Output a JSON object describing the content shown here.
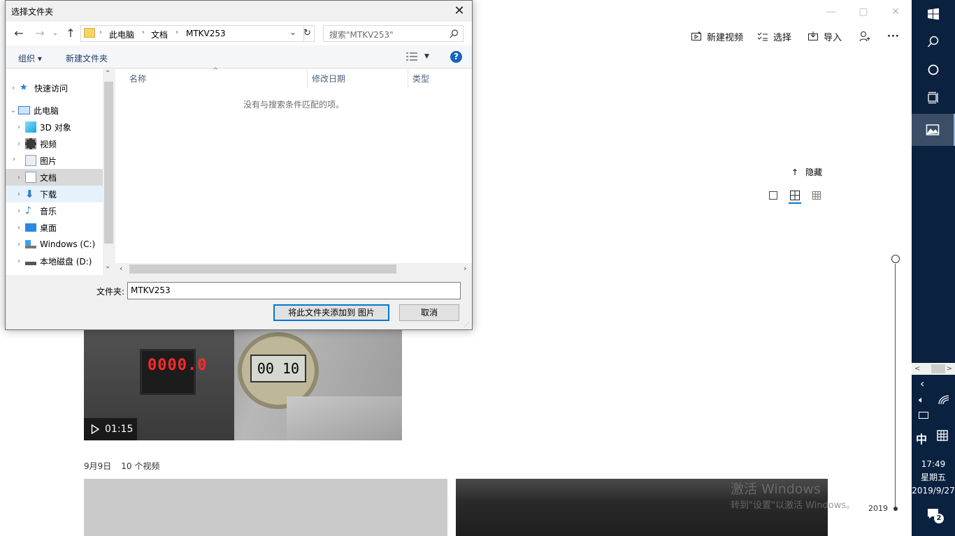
{
  "app": {
    "commands": {
      "new_video": "新建视频",
      "select": "选择",
      "import": "导入",
      "more": "···"
    },
    "hide_label": "隐藏",
    "video_duration": "01:15",
    "group_date": "9月9日",
    "group_count": "10 个视频",
    "timeline_year": "2019",
    "watermark_title": "激活 Windows",
    "watermark_sub": "转到\"设置\"以激活 Windows。"
  },
  "dialog": {
    "title": "选择文件夹",
    "breadcrumb": [
      "此电脑",
      "文档",
      "MTKV253"
    ],
    "search_placeholder": "搜索\"MTKV253\"",
    "toolbar": {
      "organize": "组织 ▾",
      "new_folder": "新建文件夹"
    },
    "nav_items": [
      {
        "label": "快速访问",
        "icon": "star-icon"
      },
      {
        "label": "此电脑",
        "icon": "computer-icon"
      },
      {
        "label": "3D 对象",
        "icon": "cube-icon"
      },
      {
        "label": "视频",
        "icon": "film-icon"
      },
      {
        "label": "图片",
        "icon": "picture-icon"
      },
      {
        "label": "文档",
        "icon": "document-icon"
      },
      {
        "label": "下载",
        "icon": "download-icon"
      },
      {
        "label": "音乐",
        "icon": "music-icon"
      },
      {
        "label": "桌面",
        "icon": "desktop-icon"
      },
      {
        "label": "Windows (C:)",
        "icon": "drive-icon"
      },
      {
        "label": "本地磁盘 (D:)",
        "icon": "disk-icon"
      }
    ],
    "columns": [
      "名称",
      "修改日期",
      "类型"
    ],
    "empty_message": "没有与搜索条件匹配的项。",
    "folder_label": "文件夹:",
    "folder_value": "MTKV253",
    "ok_button": "将此文件夹添加到 图片",
    "cancel_button": "取消"
  },
  "taskbar": {
    "ime_lang": "中",
    "time": "17:49",
    "weekday": "星期五",
    "date": "2019/9/27",
    "notification_count": "2"
  },
  "colors": {
    "taskbar_bg": "#0b2140",
    "accent": "#0078d7",
    "help_blue": "#1565c0"
  }
}
